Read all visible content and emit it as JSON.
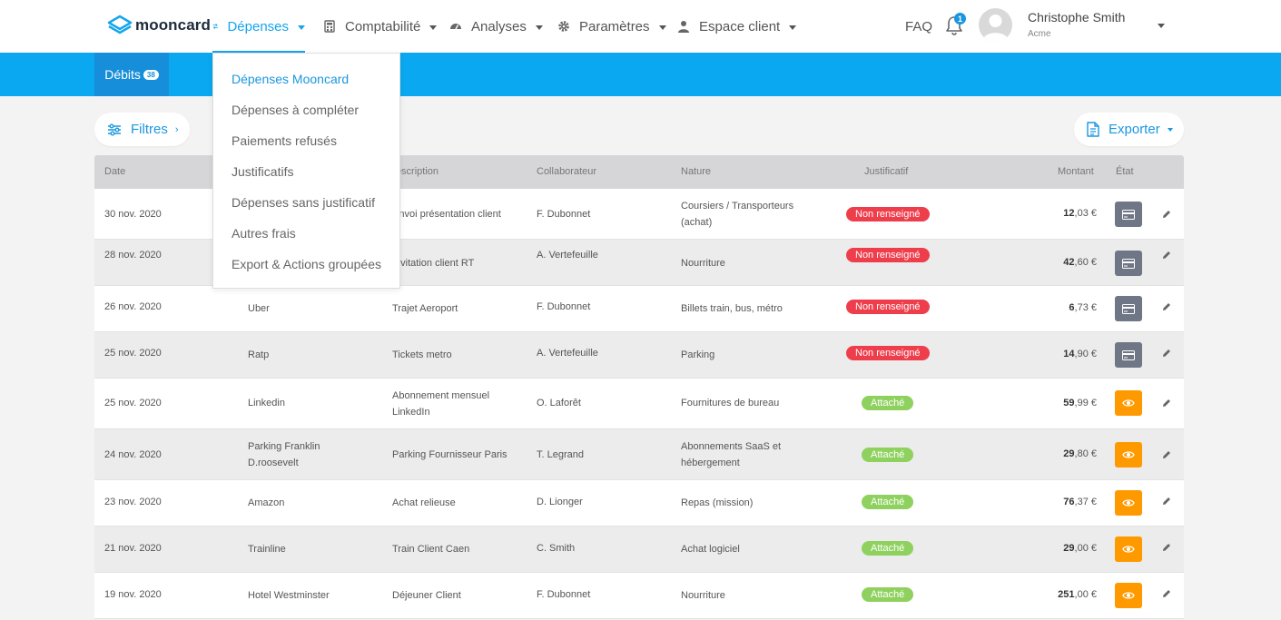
{
  "brand": {
    "name": "mooncard"
  },
  "nav": {
    "items": [
      {
        "label": "Dépenses",
        "icon": "transfer-arrows-icon",
        "active": true
      },
      {
        "label": "Comptabilité",
        "icon": "calculator-icon",
        "active": false
      },
      {
        "label": "Analyses",
        "icon": "gauge-icon",
        "active": false
      },
      {
        "label": "Paramètres",
        "icon": "gear-icon",
        "active": false
      },
      {
        "label": "Espace client",
        "icon": "user-icon",
        "active": false
      }
    ],
    "faq": "FAQ",
    "notifications_count": "1",
    "user": {
      "name": "Christophe Smith",
      "org": "Acme"
    }
  },
  "subnav": {
    "tab": "Débits",
    "count": "38"
  },
  "toolbar": {
    "filters": "Filtres",
    "export": "Exporter"
  },
  "dropdown": {
    "items": [
      "Dépenses Mooncard",
      "Dépenses à compléter",
      "Paiements refusés",
      "Justificatifs",
      "Dépenses sans justificatif",
      "Autres frais",
      "Export & Actions groupées"
    ]
  },
  "table": {
    "headers": {
      "date": "Date",
      "description": "Description",
      "collaborator": "Collaborateur",
      "nature": "Nature",
      "receipt": "Justificatif",
      "amount": "Montant",
      "state": "État"
    },
    "rows": [
      {
        "date": "30 nov. 2020",
        "merchant": "",
        "description": "Envoi présentation client",
        "collaborator": "F. Dubonnet",
        "nature": "Coursiers / Transporteurs (achat)",
        "receipt": "Non renseigné",
        "amount_int": "12",
        "amount_dec": ",03 €",
        "state": "card"
      },
      {
        "date": "28 nov. 2020",
        "merchant": "",
        "description": "Invitation client RT",
        "collaborator": "A. Vertefeuille",
        "nature": "Nourriture",
        "receipt": "Non renseigné",
        "amount_int": "42",
        "amount_dec": ",60 €",
        "state": "card"
      },
      {
        "date": "26 nov. 2020",
        "merchant": "Uber",
        "description": "Trajet Aeroport",
        "collaborator": "F. Dubonnet",
        "nature": "Billets train, bus, métro",
        "receipt": "Non renseigné",
        "amount_int": "6",
        "amount_dec": ",73 €",
        "state": "card"
      },
      {
        "date": "25 nov. 2020",
        "merchant": "Ratp",
        "description": "Tickets metro",
        "collaborator": "A. Vertefeuille",
        "nature": "Parking",
        "receipt": "Non renseigné",
        "amount_int": "14",
        "amount_dec": ",90 €",
        "state": "card"
      },
      {
        "date": "25 nov. 2020",
        "merchant": "Linkedin",
        "description": "Abonnement mensuel LinkedIn",
        "collaborator": "O. Laforêt",
        "nature": "Fournitures de bureau",
        "receipt": "Attaché",
        "amount_int": "59",
        "amount_dec": ",99 €",
        "state": "eye"
      },
      {
        "date": "24 nov. 2020",
        "merchant": "Parking Franklin D.roosevelt",
        "description": "Parking Fournisseur Paris",
        "collaborator": "T. Legrand",
        "nature": "Abonnements SaaS et hébergement",
        "receipt": "Attaché",
        "amount_int": "29",
        "amount_dec": ",80 €",
        "state": "eye"
      },
      {
        "date": "23 nov. 2020",
        "merchant": "Amazon",
        "description": "Achat relieuse",
        "collaborator": "D. Lionger",
        "nature": "Repas (mission)",
        "receipt": "Attaché",
        "amount_int": "76",
        "amount_dec": ",37 €",
        "state": "eye"
      },
      {
        "date": "21 nov. 2020",
        "merchant": "Trainline",
        "description": "Train Client Caen",
        "collaborator": "C. Smith",
        "nature": "Achat logiciel",
        "receipt": "Attaché",
        "amount_int": "29",
        "amount_dec": ",00 €",
        "state": "eye"
      },
      {
        "date": "19 nov. 2020",
        "merchant": "Hotel Westminster",
        "description": "Déjeuner Client",
        "collaborator": "F. Dubonnet",
        "nature": "Nourriture",
        "receipt": "Attaché",
        "amount_int": "251",
        "amount_dec": ",00 €",
        "state": "eye"
      }
    ]
  },
  "colors": {
    "accent": "#0aa8f0",
    "red": "#ee3e4c",
    "green": "#8fd15f",
    "orange": "#ff9900",
    "slate": "#6f7685"
  }
}
